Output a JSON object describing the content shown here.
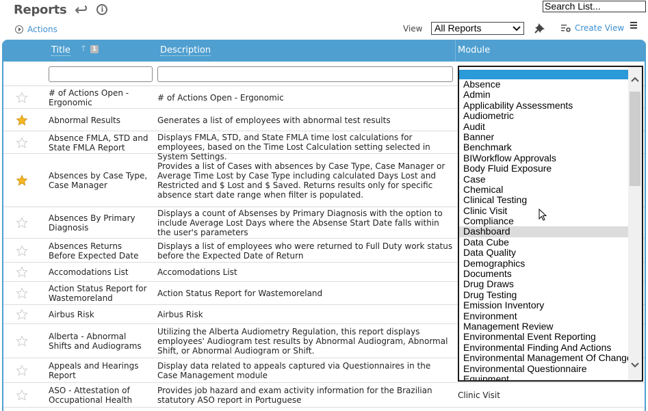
{
  "header": {
    "title": "Reports",
    "actions_label": "Actions",
    "search_placeholder": "Search List...",
    "view_label": "View",
    "view_selected": "All Reports",
    "create_view_label": "Create View"
  },
  "grid": {
    "accent_color": "#4f9fd0",
    "columns": {
      "title": "Title",
      "sort_index": "1",
      "description": "Description",
      "module": "Module"
    },
    "rows": [
      {
        "starred": false,
        "title": "# of Actions Open - Ergonomic",
        "description": "# of Actions Open - Ergonomic",
        "module": ""
      },
      {
        "starred": true,
        "title": "Abnormal Results",
        "description": "Generates a list of employees with abnormal test results",
        "module": ""
      },
      {
        "starred": false,
        "title": "Absence FMLA, STD and State FMLA Report",
        "description": "Displays FMLA, STD, and State FMLA time lost calculations for employees, based on the Time Lost Calculation setting selected in System Settings.",
        "module": ""
      },
      {
        "starred": true,
        "title": "Absences by Case Type, Case Manager",
        "description": "Provides a list of Cases with absences by Case Type, Case Manager or Average Time Lost by Case Type including calculated Days Lost and Restricted and $ Lost and $ Saved. Returns results only for specific absence start date range when filter is populated.",
        "module": ""
      },
      {
        "starred": false,
        "title": "Absences By Primary Diagnosis",
        "description": "Displays a count of Absenses by Primary Diagnosis with the option to include Average Lost Days where the Absense Start Date falls within the user's parameters",
        "module": ""
      },
      {
        "starred": false,
        "title": "Absences Returns Before Expected Date",
        "description": "Displays a list of employees who were returned to Full Duty work status before the Expected Date of Return",
        "module": ""
      },
      {
        "starred": false,
        "title": "Accomodations List",
        "description": "Accomodations List",
        "module": ""
      },
      {
        "starred": false,
        "title": "Action Status Report for Wastemoreland",
        "description": "Action Status Report for Wastemoreland",
        "module": ""
      },
      {
        "starred": false,
        "title": "Airbus Risk",
        "description": "Airbus Risk",
        "module": ""
      },
      {
        "starred": false,
        "title": "Alberta - Abnormal Shifts and Audiograms",
        "description": "Utilizing the Alberta Audiometry Regulation, this report displays employees' Audiogram test results by Abnormal Audiogram, Abnormal Shift, or Abnormal Audiogram or Shift.",
        "module": ""
      },
      {
        "starred": false,
        "title": "Appeals and Hearings Report",
        "description": "Display data related to appeals captured via Questionnaires in the Case Management module",
        "module": ""
      },
      {
        "starred": false,
        "title": "ASO - Attestation of Occupational Health",
        "description": "Provides job hazard and exam activity information for the Brazilian statutory ASO report in Portuguese",
        "module": "Clinic Visit"
      }
    ]
  },
  "module_dropdown": {
    "selected_index": 0,
    "hover_index": 15,
    "options": [
      "",
      "Absence",
      "Admin",
      "Applicability Assessments",
      "Audiometric",
      "Audit",
      "Banner",
      "Benchmark",
      "BIWorkflow Approvals",
      "Body Fluid Exposure",
      "Case",
      "Chemical",
      "Clinical Testing",
      "Clinic Visit",
      "Compliance",
      "Dashboard",
      "Data Cube",
      "Data Quality",
      "Demographics",
      "Documents",
      "Drug Draws",
      "Drug Testing",
      "Emission Inventory",
      "Environment",
      "Management Review",
      "Environmental Event Reporting",
      "Environmental Finding And Actions",
      "Environmental Management Of Change",
      "Environmental Questionnaire",
      "Equipment"
    ]
  }
}
